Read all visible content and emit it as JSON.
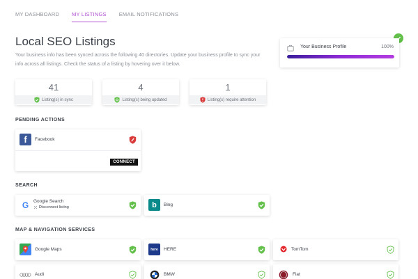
{
  "nav": {
    "tabs": [
      {
        "label": "MY DASHBOARD"
      },
      {
        "label": "MY LISTINGS"
      },
      {
        "label": "EMAIL NOTIFICATIONS"
      }
    ],
    "active_index": 1
  },
  "header": {
    "title": "Local SEO Listings",
    "description": "Your business info has been synced across the following 40 directories. Update your business profile to sync your info across all listings. Check the status of a listing by hovering over it below."
  },
  "stats": [
    {
      "value": "41",
      "label": "Listing(s) in sync",
      "status": "synced"
    },
    {
      "value": "4",
      "label": "Listing(s) being updated",
      "status": "updating"
    },
    {
      "value": "1",
      "label": "Listing(s) require attention",
      "status": "attention"
    }
  ],
  "profile": {
    "title": "Your Business Profile",
    "percent_label": "100%",
    "percent": 100
  },
  "sections": {
    "pending": "PENDING ACTIONS",
    "search": "SEARCH",
    "map": "MAP & NAVIGATION SERVICES"
  },
  "pending_card": {
    "name": "Facebook",
    "action_label": "CONNECT"
  },
  "search_cards": [
    {
      "name": "Google Search",
      "sub_label": "Disconnect listing"
    },
    {
      "name": "Bing"
    }
  ],
  "map_cards": [
    {
      "name": "Google Maps"
    },
    {
      "name": "HERE"
    },
    {
      "name": "TomTom"
    },
    {
      "name": "Audi"
    },
    {
      "name": "BMW"
    },
    {
      "name": "Fiat"
    }
  ],
  "colors": {
    "accent": "#b04fd1",
    "synced": "#63c04a",
    "attention": "#d93a3a",
    "bar_start": "#3a1d9a",
    "bar_end": "#b43de0"
  },
  "icons": {
    "synced": "shield-check-icon",
    "updating": "shield-sync-icon",
    "attention": "shield-alert-icon"
  }
}
